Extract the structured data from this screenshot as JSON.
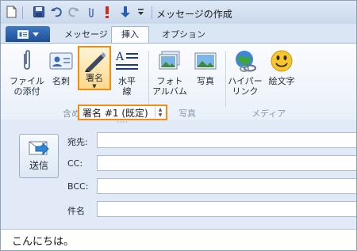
{
  "window": {
    "title": "メッセージの作成"
  },
  "tabs": {
    "file_tab": "File",
    "items": [
      "メッセージ",
      "挿入",
      "オプション"
    ],
    "active": "挿入"
  },
  "ribbon": {
    "buttons": {
      "attach": "ファイル\nの添付",
      "business_card": "名刺",
      "signature": "署名",
      "horizontal_line": "水平\n線",
      "photo_album": "フォト\nアルバム",
      "photo": "写真",
      "hyperlink": "ハイパー\nリンク",
      "emoji": "絵文字"
    },
    "groups": {
      "include": "含め",
      "photos": "写真",
      "media": "メディア"
    }
  },
  "signature_combo": {
    "value": "署名 #1 (既定)"
  },
  "compose": {
    "send_label": "送信",
    "fields": {
      "to": "宛先:",
      "cc": "CC:",
      "bcc": "BCC:",
      "subject": "件名"
    }
  },
  "message_body": {
    "text": "こんにちは。"
  },
  "colors": {
    "highlight": "#f08c18",
    "accent": "#1f4f94"
  }
}
